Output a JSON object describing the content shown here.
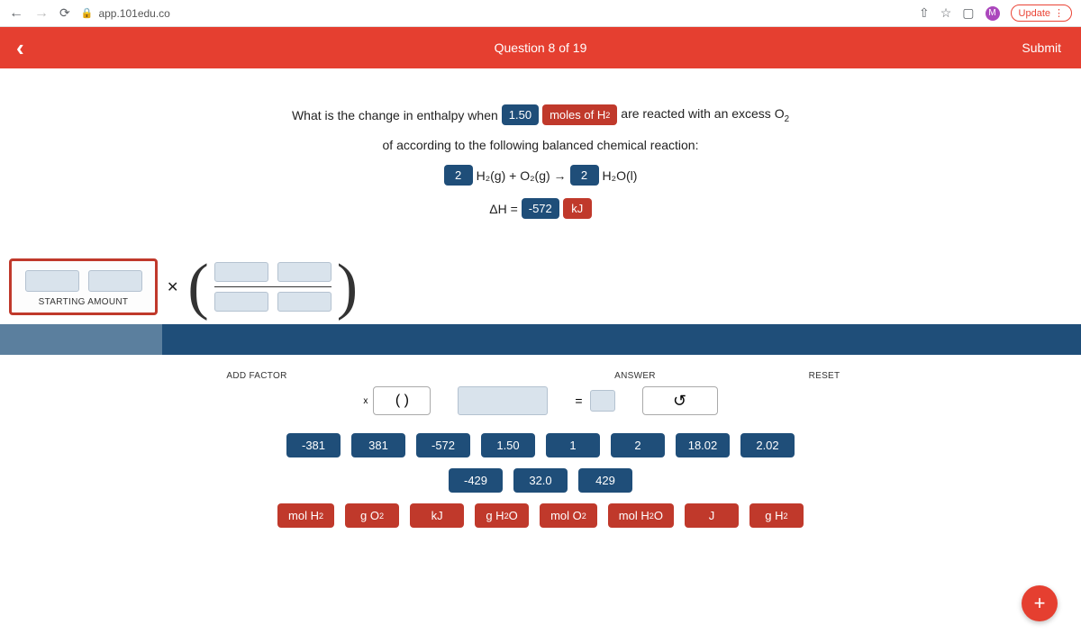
{
  "browser": {
    "url": "app.101edu.co",
    "update_label": "Update",
    "profile_initial": "M"
  },
  "header": {
    "question_label": "Question 8 of 19",
    "submit_label": "Submit"
  },
  "question": {
    "prefix": "What is the change in enthalpy when",
    "value_pill": "1.50",
    "moles_pill": "moles of H",
    "suffix1": "are reacted with an excess O",
    "line2": "of according to the following balanced chemical reaction:",
    "coef1": "2",
    "eq_mid": "H₂(g) + O₂(g) →",
    "coef2": "2",
    "eq_end": "H₂O(l)",
    "dh_prefix": "ΔH =",
    "dh_val": "-572",
    "dh_unit": "kJ"
  },
  "starting_label": "STARTING AMOUNT",
  "controls": {
    "add_factor_label": "ADD FACTOR",
    "answer_label": "ANSWER",
    "reset_label": "RESET",
    "x_sym": "x",
    "paren_content": "(   )",
    "equals": "=",
    "reset_icon": "↺"
  },
  "num_tiles_row1": [
    "-381",
    "381",
    "-572",
    "1.50",
    "1",
    "2",
    "18.02",
    "2.02"
  ],
  "num_tiles_row2": [
    "-429",
    "32.0",
    "429"
  ],
  "unit_tiles": [
    {
      "t": "mol H",
      "sub": "2"
    },
    {
      "t": "g O",
      "sub": "2"
    },
    {
      "t": "kJ",
      "sub": ""
    },
    {
      "t": "g H",
      "sub": "2",
      "extra": "O"
    },
    {
      "t": "mol O",
      "sub": "2"
    },
    {
      "t": "mol H",
      "sub": "2",
      "extra": "O"
    },
    {
      "t": "J",
      "sub": ""
    },
    {
      "t": "g H",
      "sub": "2"
    }
  ],
  "fab": "+"
}
